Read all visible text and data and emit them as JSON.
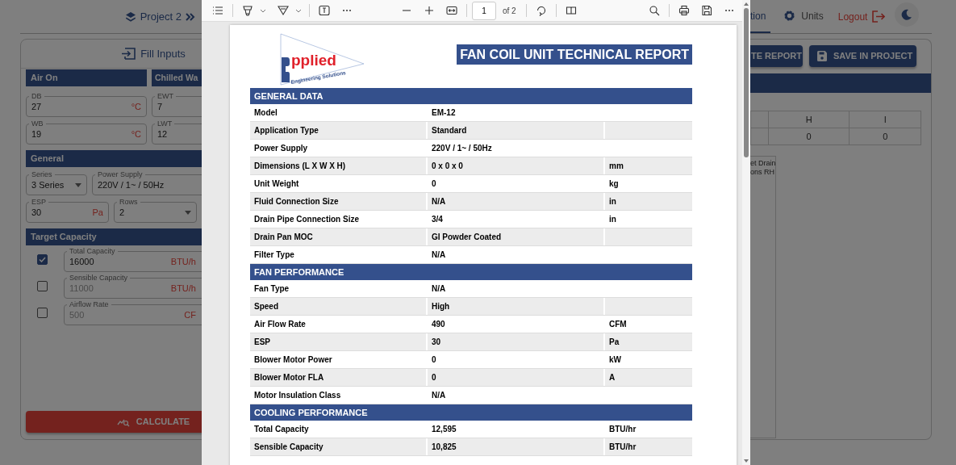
{
  "project": {
    "name": "Project 2"
  },
  "nav": [
    {
      "label": "tion",
      "selected": true
    },
    {
      "label": "Units",
      "selected": false
    }
  ],
  "logout": "Logout",
  "fill_inputs": {
    "title": "Fill Inputs",
    "air_on": {
      "title": "Air On",
      "fields": [
        {
          "label": "DB",
          "value": "27",
          "unit": "°C"
        },
        {
          "label": "WB",
          "value": "19",
          "unit": "°C"
        }
      ]
    },
    "chilled_water": {
      "title": "Chilled Wa",
      "fields": [
        {
          "label": "EWT",
          "value": "7"
        },
        {
          "label": "LWT",
          "value": "12"
        }
      ]
    },
    "general": {
      "title": "General",
      "rows": [
        [
          {
            "kind": "select",
            "label": "Series",
            "value": "3 Series"
          },
          {
            "kind": "text",
            "label": "Power Supply",
            "value": "220V / 1~ / 50Hz"
          }
        ],
        [
          {
            "kind": "text",
            "label": "ESP",
            "value": "30",
            "unit": "Pa"
          },
          {
            "kind": "select",
            "label": "Rows",
            "value": "2"
          }
        ]
      ]
    },
    "target_capacity": {
      "title": "Target Capacity",
      "items": [
        {
          "label": "Total Capacity",
          "value": "16000",
          "unit": "BTU/h",
          "checked": true
        },
        {
          "label": "Sensible Capacity",
          "value": "11000",
          "unit": "BTU/h",
          "checked": false
        },
        {
          "label": "Airflow Rate",
          "value": "500",
          "unit": "CF",
          "checked": false
        }
      ]
    },
    "calculate_button": "CALCULATE"
  },
  "report_actions": [
    {
      "label": "TE REPORT"
    },
    {
      "label": "SAVE IN PROJECT"
    }
  ],
  "results_table": {
    "columns": [
      "H",
      "I"
    ],
    "rows": [
      [
        "0",
        "0"
      ]
    ]
  },
  "drawing_note": [
    "et Drain",
    "ons RH"
  ],
  "pdf_viewer": {
    "page_number": "1",
    "page_total": "of 2",
    "report": {
      "logo": {
        "wordmark": "pplied",
        "tagline": "Engineering Solutions"
      },
      "title": "FAN COIL UNIT TECHNICAL REPORT",
      "sections": [
        {
          "title": "GENERAL DATA",
          "rows": [
            {
              "label": "Model",
              "value": "EM-12"
            },
            {
              "label": "Application Type",
              "value": "Standard"
            },
            {
              "label": "Power Supply",
              "value": "220V / 1~ / 50Hz"
            },
            {
              "label": "Dimensions (L X W X H)",
              "value": "0 x 0 x 0",
              "unit": "mm"
            },
            {
              "label": "Unit Weight",
              "value": "0",
              "unit": "kg"
            },
            {
              "label": "Fluid Connection Size",
              "value": "N/A",
              "unit": "in"
            },
            {
              "label": "Drain Pipe Connection Size",
              "value": "3/4",
              "unit": "in"
            },
            {
              "label": "Drain Pan MOC",
              "value": "GI Powder Coated"
            },
            {
              "label": "Filter Type",
              "value": "N/A"
            }
          ]
        },
        {
          "title": "FAN PERFORMANCE",
          "rows": [
            {
              "label": "Fan Type",
              "value": "N/A"
            },
            {
              "label": "Speed",
              "value": "High"
            },
            {
              "label": "Air Flow Rate",
              "value": "490",
              "unit": "CFM"
            },
            {
              "label": "ESP",
              "value": "30",
              "unit": "Pa"
            },
            {
              "label": "Blower Motor Power",
              "value": "0",
              "unit": "kW"
            },
            {
              "label": "Blower Motor FLA",
              "value": "0",
              "unit": "A"
            },
            {
              "label": "Motor Insulation Class",
              "value": "N/A"
            }
          ]
        },
        {
          "title": "COOLING PERFORMANCE",
          "rows": [
            {
              "label": "Total Capacity",
              "value": "12,595",
              "unit": "BTU/hr"
            },
            {
              "label": "Sensible Capacity",
              "value": "10,825",
              "unit": "BTU/hr"
            }
          ]
        }
      ]
    }
  }
}
